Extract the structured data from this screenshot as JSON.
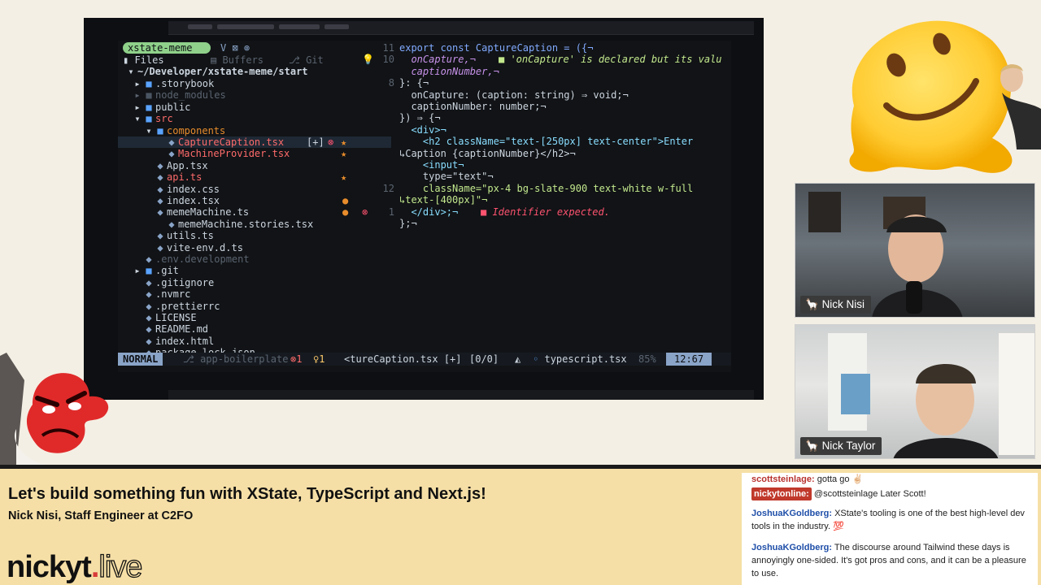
{
  "editor": {
    "explorer_label": "xstate-meme",
    "tabs": [
      "Files",
      "Buffers",
      "Git"
    ],
    "root_path": "~/Developer/xstate-meme/start",
    "tree": [
      {
        "name": ".storybook",
        "type": "folder"
      },
      {
        "name": "node_modules",
        "type": "folder",
        "dim": true
      },
      {
        "name": "public",
        "type": "folder"
      },
      {
        "name": "src",
        "type": "folder",
        "open": true
      },
      {
        "name": "components",
        "type": "folder",
        "open": true
      },
      {
        "name": "CaptureCaption.tsx",
        "type": "file",
        "status": "[+]",
        "selected": true
      },
      {
        "name": "MachineProvider.tsx",
        "type": "file"
      },
      {
        "name": "App.tsx",
        "type": "file"
      },
      {
        "name": "api.ts",
        "type": "file"
      },
      {
        "name": "index.css",
        "type": "file"
      },
      {
        "name": "index.tsx",
        "type": "file"
      },
      {
        "name": "memeMachine.ts",
        "type": "file"
      },
      {
        "name": "memeMachine.stories.tsx",
        "type": "file"
      },
      {
        "name": "utils.ts",
        "type": "file"
      },
      {
        "name": "vite-env.d.ts",
        "type": "file"
      },
      {
        "name": ".env.development",
        "type": "file",
        "dim": true
      },
      {
        "name": ".git",
        "type": "folder"
      },
      {
        "name": ".gitignore",
        "type": "file"
      },
      {
        "name": ".nvmrc",
        "type": "file"
      },
      {
        "name": ".prettierrc",
        "type": "file"
      },
      {
        "name": "LICENSE",
        "type": "file"
      },
      {
        "name": "README.md",
        "type": "file"
      },
      {
        "name": "index.html",
        "type": "file"
      },
      {
        "name": "package-lock.json",
        "type": "file"
      }
    ],
    "code": [
      {
        "ln": "11",
        "text": "export const CaptureCaption = ({¬"
      },
      {
        "ln": "10",
        "text": "  onCapture,¬",
        "diag": "■ 'onCapture' is declared but its valu"
      },
      {
        "ln": "",
        "text": "  captionNumber,¬"
      },
      {
        "ln": "8",
        "text": "}: {¬"
      },
      {
        "ln": "",
        "text": "  onCapture: (caption: string) ⇒ void;¬"
      },
      {
        "ln": "",
        "text": "  captionNumber: number;¬"
      },
      {
        "ln": "",
        "text": "}) ⇒ {¬"
      },
      {
        "ln": "",
        "text": "  <div>¬"
      },
      {
        "ln": "",
        "text": "    <h2 className=\"text-[250px] text-center\">Enter"
      },
      {
        "ln": "",
        "text": "↳Caption {captionNumber}</h2>¬"
      },
      {
        "ln": "",
        "text": "    <input¬"
      },
      {
        "ln": "",
        "text": "    type=\"text\"¬"
      },
      {
        "ln": "12",
        "text": "    className=\"px-4 bg-slate-900 text-white w-full"
      },
      {
        "ln": "",
        "text": "↳text-[400px]\"¬"
      },
      {
        "ln": "1",
        "text": "  </div>;¬",
        "diag": "■ Identifier expected."
      },
      {
        "ln": "",
        "text": "};¬"
      }
    ],
    "statusline": {
      "mode": "NORMAL",
      "branch": "app-boilerplate",
      "errors": "⊗1",
      "hints": "♀1",
      "file": "<tureCaption.tsx [+]",
      "search": "[0/0]",
      "filetype": "typescript.tsx",
      "percent": "85%",
      "position": "12:67"
    }
  },
  "webcams": [
    {
      "name": "Nick Nisi"
    },
    {
      "name": "Nick Taylor"
    }
  ],
  "lower_third": {
    "title": "Let's build something fun with XState, TypeScript and Next.js!",
    "subtitle": "Nick Nisi, Staff Engineer at C2FO",
    "brand_main": "nickyt",
    "brand_dot": ".",
    "brand_live": "live"
  },
  "chat": [
    {
      "user": "scottsteinlage:",
      "text": "gotta go ✌🏻"
    },
    {
      "user": "nickytonline:",
      "text": "@scottsteinlage Later Scott!",
      "badge": true
    },
    {
      "user": "JoshuaKGoldberg:",
      "text": "XState's tooling is one of the best high-level dev tools in the industry. 💯"
    },
    {
      "user": "JoshuaKGoldberg:",
      "text": "The discourse around Tailwind these days is annoyingly one-sided. It's got pros and cons, and it can be a pleasure to use."
    }
  ],
  "colors": {
    "lower_third_bg": "#f6dfa6",
    "brand_dot": "#d83a3a",
    "statusline_accent": "#8aa4c8",
    "explorer_badge": "#8fd18a"
  }
}
